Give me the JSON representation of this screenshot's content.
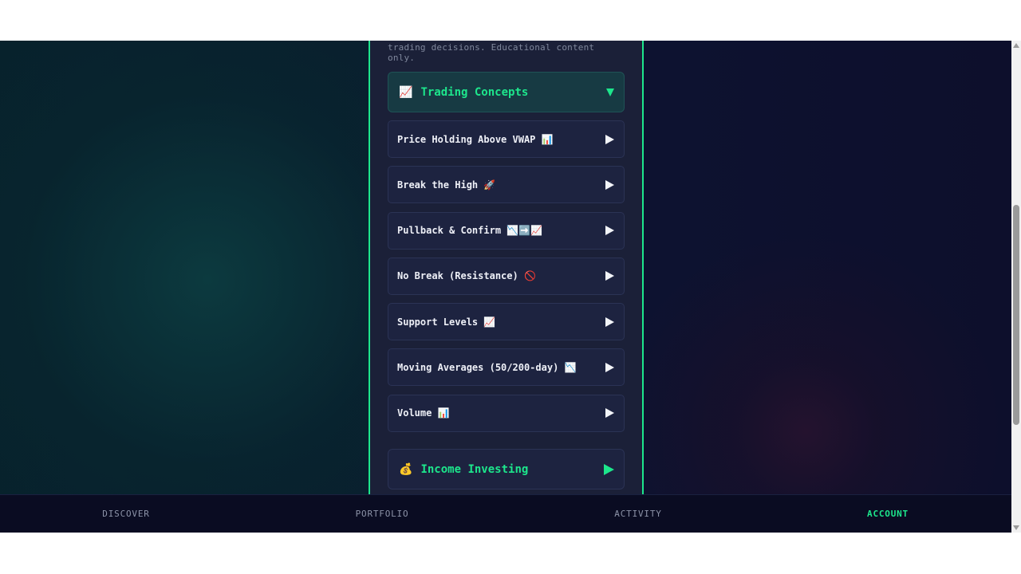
{
  "intro": {
    "text": "trading decisions. Educational content only."
  },
  "trading_concepts": {
    "emoji": "📈",
    "title": "Trading Concepts",
    "items": [
      {
        "label": "Price Holding Above VWAP 📊"
      },
      {
        "label": "Break the High 🚀"
      },
      {
        "label": "Pullback & Confirm 📉➡️📈"
      },
      {
        "label": "No Break (Resistance) 🚫"
      },
      {
        "label": "Support Levels 📈"
      },
      {
        "label": "Moving Averages (50/200-day) 📉"
      },
      {
        "label": "Volume 📊"
      }
    ]
  },
  "income_investing": {
    "emoji": "💰",
    "title": "Income Investing"
  },
  "bottom_nav": {
    "items": [
      {
        "label": "DISCOVER"
      },
      {
        "label": "PORTFOLIO"
      },
      {
        "label": "ACTIVITY"
      },
      {
        "label": "ACCOUNT"
      }
    ],
    "active": "ACCOUNT"
  },
  "colors": {
    "accent": "#1de68c",
    "panel_bg": "#1b2038",
    "nav_bg": "#0a0c22",
    "muted_text": "#8c93a8"
  }
}
